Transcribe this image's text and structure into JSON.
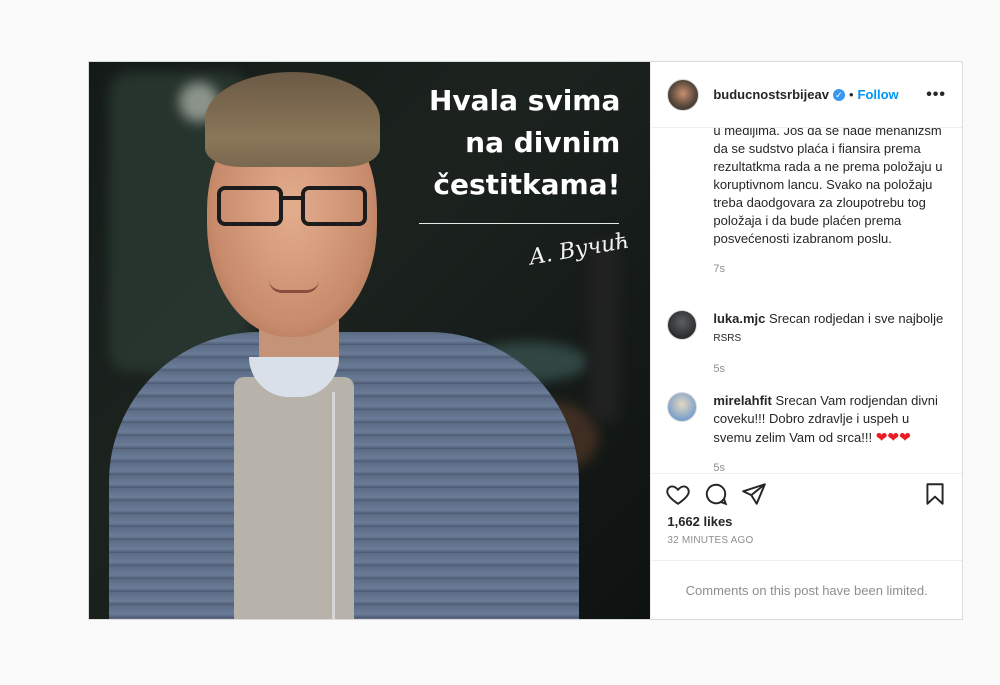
{
  "image_text": {
    "line1": "Hvala svima",
    "line2": "na divnim",
    "line3": "čestitkama!",
    "signature": "A. Вучић"
  },
  "post": {
    "username": "buducnostsrbijeav",
    "verified_mark": "✓",
    "separator": "•",
    "follow_label": "Follow",
    "more_label": "•••"
  },
  "caption": {
    "text": "u medijima. Još da se nađe mehanizsm da se sudstvo plaća i fiansira prema rezultatkma rada a ne prema položaju u koruptivnom lancu. Svako na položaju treba daodgovara za zloupotrebu tog položaja i da bude plaćen prema posvećenosti izabranom poslu.",
    "time": "7s"
  },
  "comments": [
    {
      "user": "luka.mjc",
      "text": "Srecan rodjedan i sve najbolje",
      "suffix": "RSRS",
      "time": "5s"
    },
    {
      "user": "mirelahfit",
      "text": "Srecan Vam rodjendan divni coveku!!! Dobro zdravlje i uspeh u svemu zelim Vam od srca!!!",
      "suffix": "❤❤❤",
      "time": "5s"
    }
  ],
  "likes": "1,662 likes",
  "posted_ago": "32 MINUTES AGO",
  "comments_limited": "Comments on this post have been limited.",
  "icons": {
    "like": "heart-icon",
    "comment": "comment-icon",
    "share": "share-icon",
    "save": "bookmark-icon"
  },
  "colors": {
    "accent": "#0095f6",
    "verified": "#3897f0",
    "muted": "#8e8e8e",
    "heart": "#ed1b24"
  }
}
